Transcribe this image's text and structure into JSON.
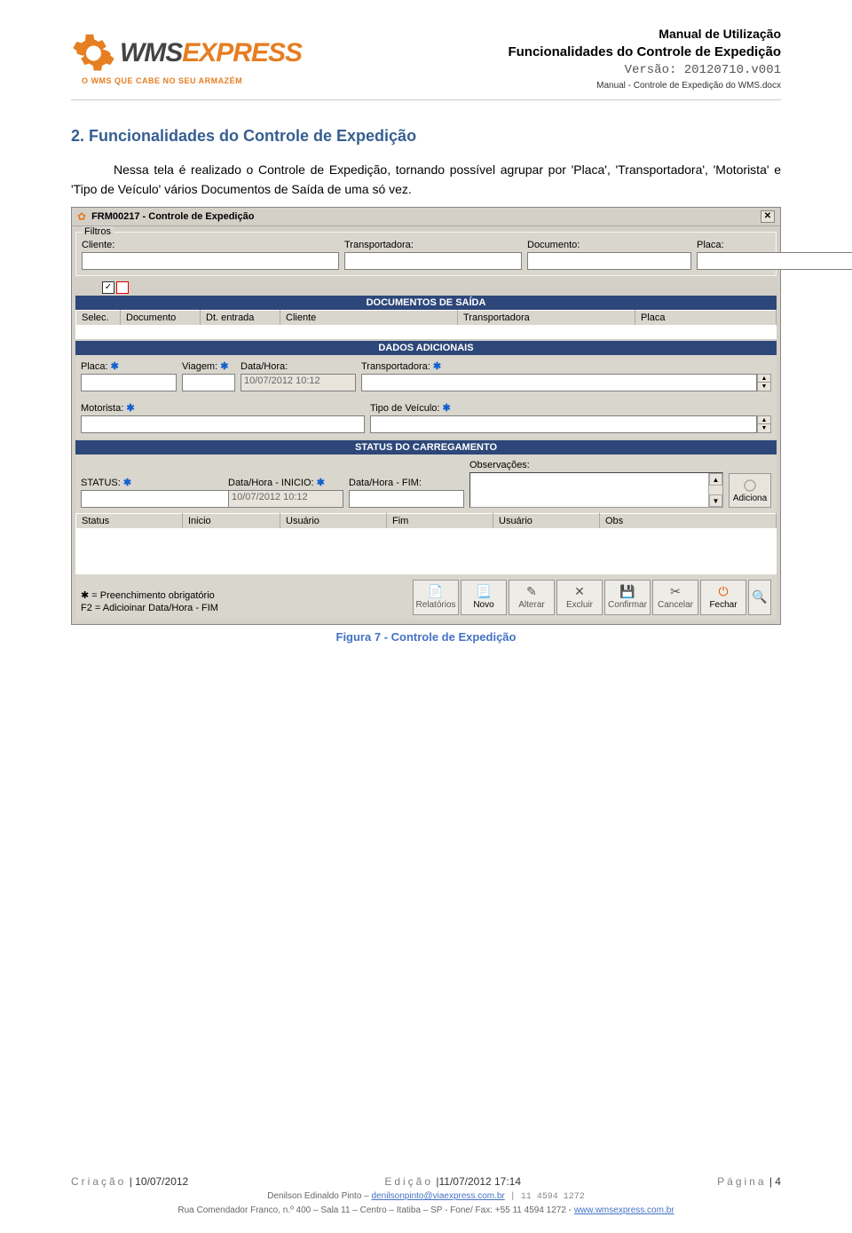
{
  "header": {
    "doc_title": "Manual de Utilização",
    "subtitle": "Funcionalidades do Controle de Expedição",
    "version_label": "Versão: 20120710.v001",
    "doc_file": "Manual - Controle de Expedição do WMS.docx",
    "logo_text_w": "WMS",
    "logo_text_rest": "EXPRESS",
    "logo_tagline": "O WMS QUE CABE NO SEU ARMAZÉM"
  },
  "section": {
    "heading": "2. Funcionalidades do Controle de Expedição",
    "paragraph": "Nessa tela é realizado o Controle de Expedição, tornando possível agrupar por 'Placa', 'Transportadora', 'Motorista' e 'Tipo de Veículo' vários Documentos de Saída de uma só vez."
  },
  "screenshot": {
    "window_title": "FRM00217 - Controle de Expedição",
    "filters": {
      "legend": "Filtros",
      "cliente_label": "Cliente:",
      "transportadora_label": "Transportadora:",
      "documento_label": "Documento:",
      "placa_label": "Placa:"
    },
    "docs_saida": {
      "section": "DOCUMENTOS DE SAÍDA",
      "columns": [
        "Selec.",
        "Documento",
        "Dt. entrada",
        "Cliente",
        "Transportadora",
        "Placa"
      ]
    },
    "dados_adicionais": {
      "section": "DADOS ADICIONAIS",
      "placa_label": "Placa:",
      "viagem_label": "Viagem:",
      "datahora_label": "Data/Hora:",
      "datahora_value": "10/07/2012 10:12",
      "transportadora_label": "Transportadora:",
      "motorista_label": "Motorista:",
      "tipoveiculo_label": "Tipo de Veículo:"
    },
    "status_carregamento": {
      "section": "STATUS DO CARREGAMENTO",
      "status_label": "STATUS:",
      "dh_inicio_label": "Data/Hora - INICIO:",
      "dh_inicio_value": "10/07/2012 10:12",
      "dh_fim_label": "Data/Hora - FIM:",
      "obs_label": "Observações:",
      "adiciona_label": "Adiciona",
      "columns": [
        "Status",
        "Inicio",
        "Usuário",
        "Fim",
        "Usuário",
        "Obs"
      ]
    },
    "bottom": {
      "req_note": "✱ = Preenchimento obrigatório",
      "f2_note": "F2 = Adicioinar Data/Hora - FIM",
      "buttons": {
        "relatorios": "Relatórios",
        "novo": "Novo",
        "alterar": "Alterar",
        "excluir": "Excluir",
        "confirmar": "Confirmar",
        "cancelar": "Cancelar",
        "fechar": "Fechar"
      }
    }
  },
  "figure_caption": "Figura 7 - Controle de Expedição",
  "footer": {
    "criacao_label": "Criação",
    "criacao_value": "| 10/07/2012",
    "edicao_label": "Edição",
    "edicao_value": "|11/07/2012 17:14",
    "pagina_label": "Página",
    "pagina_value": "| 4",
    "author_line": "Denilson Edinaldo Pinto – ",
    "author_email": "denilsonpinto@viaexpress.com.br",
    "author_phone": " | 11 4594 1272",
    "address_line": "Rua Comendador Franco, n.º 400 – Sala 11 – Centro – Itatiba – SP - Fone/ Fax: +55 11 4594 1272 - ",
    "website": "www.wmsexpress.com.br"
  }
}
